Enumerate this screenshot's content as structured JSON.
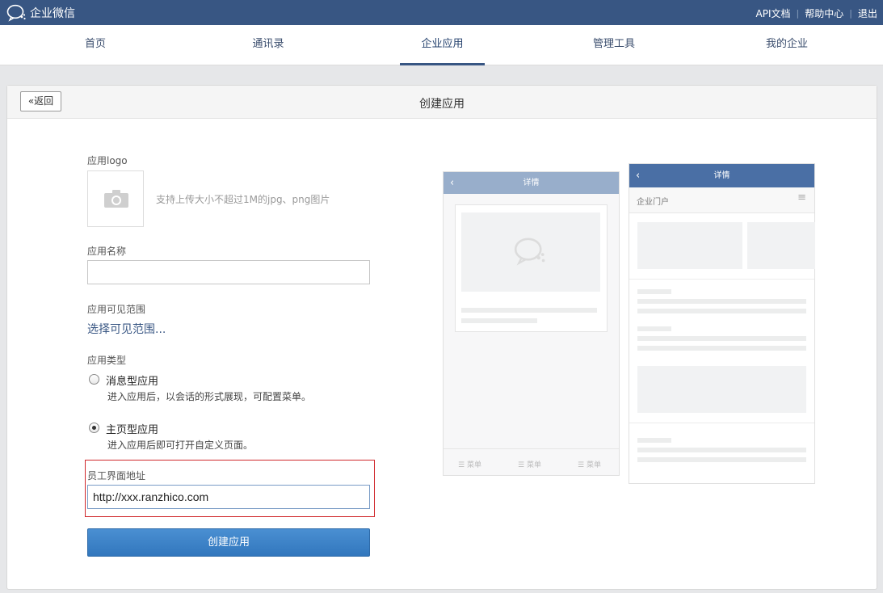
{
  "topbar": {
    "app_name": "企业微信",
    "links": [
      "API文档",
      "帮助中心",
      "退出"
    ]
  },
  "nav": {
    "tabs": [
      "首页",
      "通讯录",
      "企业应用",
      "管理工具",
      "我的企业"
    ],
    "active": "企业应用"
  },
  "page": {
    "back_label": "返回",
    "title": "创建应用"
  },
  "form": {
    "logo_label": "应用logo",
    "logo_hint": "支持上传大小不超过1M的jpg、png图片",
    "name_label": "应用名称",
    "name_value": "",
    "scope_label": "应用可见范围",
    "scope_link": "选择可见范围...",
    "type_label": "应用类型",
    "types": [
      {
        "label": "消息型应用",
        "desc": "进入应用后，以会话的形式展现，可配置菜单。",
        "checked": false
      },
      {
        "label": "主页型应用",
        "desc": "进入应用后即可打开自定义页面。",
        "checked": true
      }
    ],
    "url_label": "员工界面地址",
    "url_value": "http://xxx.ranzhico.com",
    "submit_label": "创建应用"
  },
  "preview": {
    "message_title": "详情",
    "menu_items": [
      "菜单",
      "菜单",
      "菜单"
    ],
    "home_title": "详情",
    "home_subtitle": "企业门户"
  },
  "colors": {
    "topbar": "#385683",
    "primary": "#3a80c6",
    "highlight": "#d0282c"
  }
}
